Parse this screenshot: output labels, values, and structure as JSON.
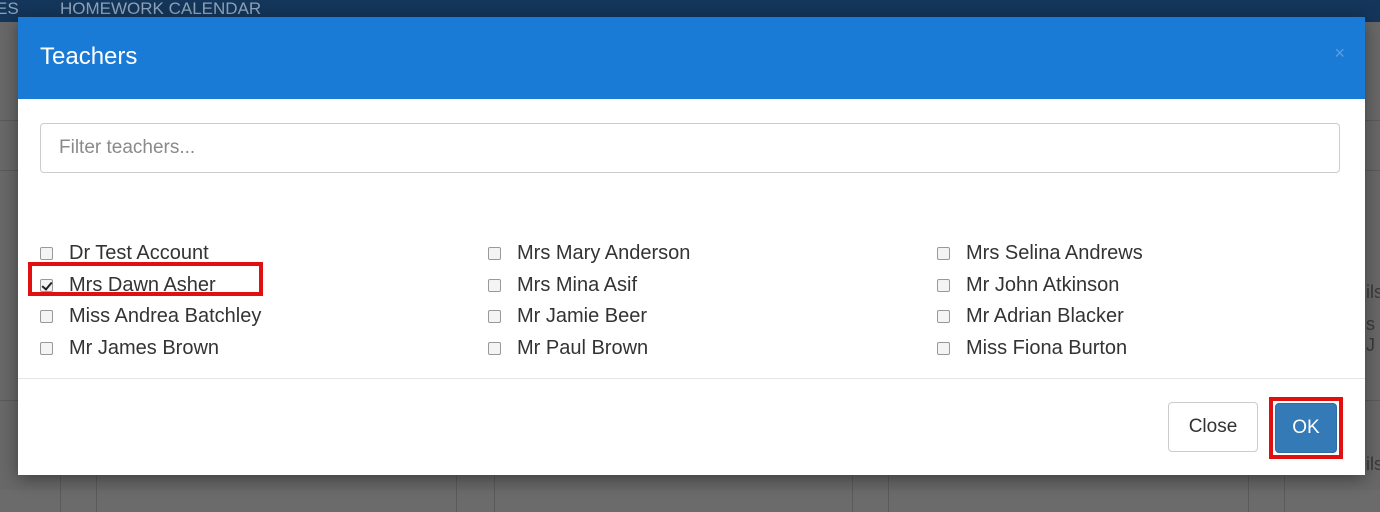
{
  "background": {
    "nav_partial": "ES",
    "nav_homework": "HOMEWORK CALENDAR",
    "right_fragments": [
      "ils",
      "s J",
      "ils"
    ]
  },
  "modal": {
    "title": "Teachers",
    "close_icon": "×",
    "filter": {
      "placeholder": "Filter teachers...",
      "value": ""
    },
    "teachers": [
      {
        "name": "Dr Test Account",
        "checked": false
      },
      {
        "name": "Mrs Mary Anderson",
        "checked": false
      },
      {
        "name": "Mrs Selina Andrews",
        "checked": false
      },
      {
        "name": "Mrs Dawn Asher",
        "checked": true
      },
      {
        "name": "Mrs Mina Asif",
        "checked": false
      },
      {
        "name": "Mr John Atkinson",
        "checked": false
      },
      {
        "name": "Miss Andrea Batchley",
        "checked": false
      },
      {
        "name": "Mr Jamie Beer",
        "checked": false
      },
      {
        "name": "Mr Adrian Blacker",
        "checked": false
      },
      {
        "name": "Mr James Brown",
        "checked": false
      },
      {
        "name": "Mr Paul Brown",
        "checked": false
      },
      {
        "name": "Miss Fiona Burton",
        "checked": false
      }
    ],
    "footer": {
      "close_label": "Close",
      "ok_label": "OK"
    }
  },
  "colors": {
    "header": "#1a7bd6",
    "primary_button": "#337ab7",
    "highlight": "#e01010"
  }
}
